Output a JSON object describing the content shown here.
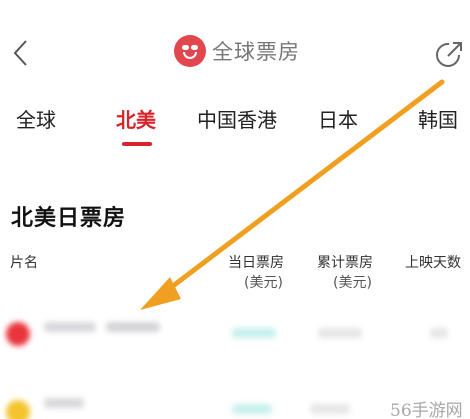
{
  "header": {
    "back_icon": "chevron-left-icon",
    "title": "全球票房",
    "logo_icon": "smiley-logo-icon",
    "share_icon": "share-icon"
  },
  "tabs": [
    {
      "label": "全球",
      "active": false
    },
    {
      "label": "北美",
      "active": true
    },
    {
      "label": "中国香港",
      "active": false
    },
    {
      "label": "日本",
      "active": false
    },
    {
      "label": "韩国",
      "active": false
    }
  ],
  "section": {
    "title": "北美日票房"
  },
  "table": {
    "columns": [
      {
        "label": "片名",
        "sub": ""
      },
      {
        "label": "当日票房",
        "sub": "(美元)"
      },
      {
        "label": "累计票房",
        "sub": "(美元)"
      },
      {
        "label": "上映天数",
        "sub": ""
      }
    ]
  },
  "colors": {
    "accent": "#d8232a",
    "arrow": "#f0a020"
  },
  "watermark": "56手游网"
}
